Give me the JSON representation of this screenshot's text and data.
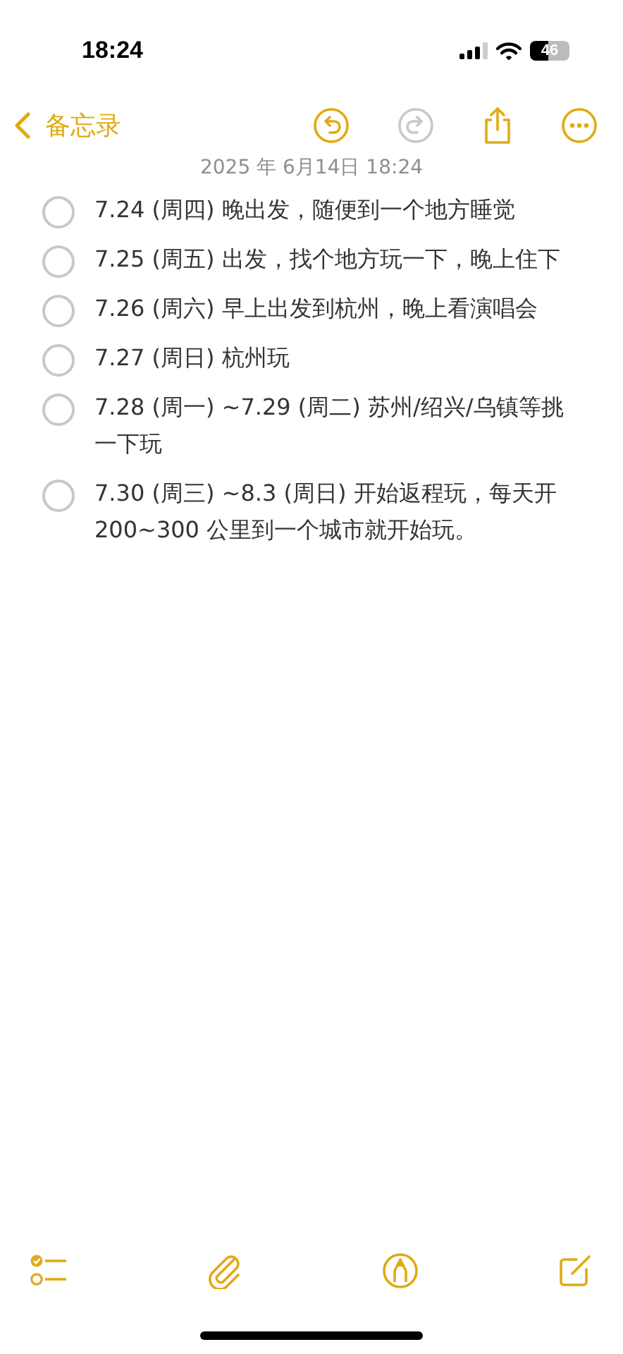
{
  "status_bar": {
    "time": "18:24",
    "battery": "46"
  },
  "nav": {
    "back_label": "备忘录",
    "undo": {
      "disabled": false
    },
    "redo": {
      "disabled": true
    }
  },
  "date": "2025 年 6月14日 18:24",
  "checklist": [
    {
      "text": "7.24 (周四) 晚出发，随便到一个地方睡觉",
      "checked": false
    },
    {
      "text": "7.25 (周五) 出发，找个地方玩一下，晚上住下",
      "checked": false
    },
    {
      "text": "7.26 (周六) 早上出发到杭州，晚上看演唱会",
      "checked": false
    },
    {
      "text": "7.27 (周日) 杭州玩",
      "checked": false
    },
    {
      "text": "7.28 (周一) ~7.29 (周二) 苏州/绍兴/乌镇等挑一下玩",
      "checked": false
    },
    {
      "text": "7.30 (周三) ~8.3 (周日) 开始返程玩，每天开 200~300 公里到一个城市就开始玩。",
      "checked": false
    }
  ]
}
